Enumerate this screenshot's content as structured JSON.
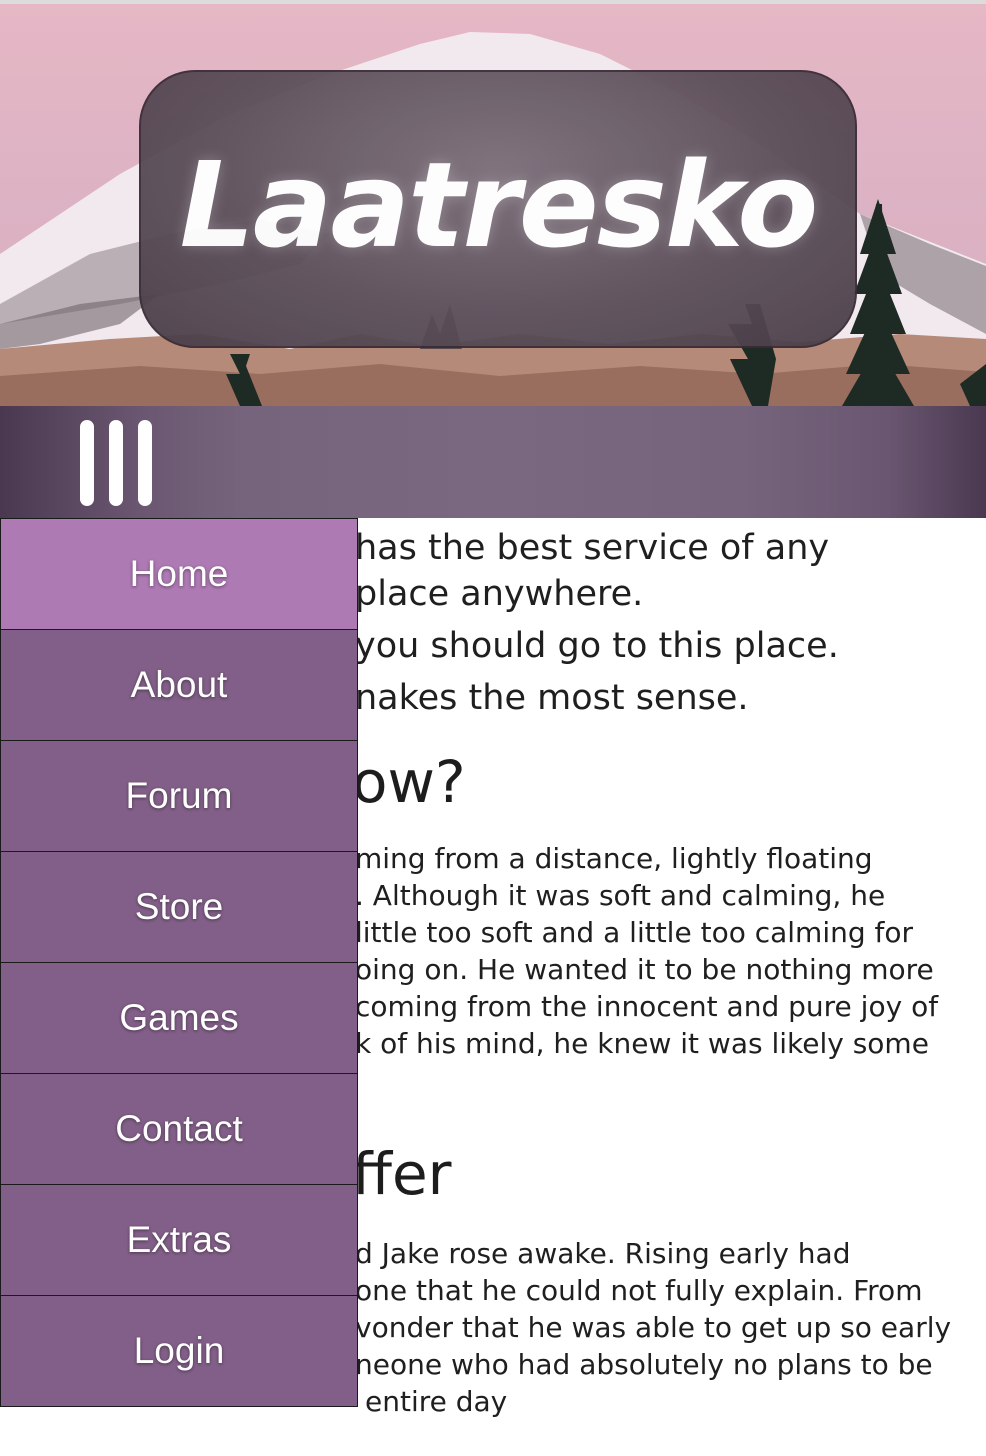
{
  "site": {
    "title": "Laatresko"
  },
  "nav": {
    "menu_icon": "hamburger-menu-icon",
    "items": [
      {
        "label": "Home",
        "active": true
      },
      {
        "label": "About",
        "active": false
      },
      {
        "label": "Forum",
        "active": false
      },
      {
        "label": "Store",
        "active": false
      },
      {
        "label": "Games",
        "active": false
      },
      {
        "label": "Contact",
        "active": false
      },
      {
        "label": "Extras",
        "active": false
      },
      {
        "label": "Login",
        "active": false
      }
    ]
  },
  "article": {
    "intro_lines": [
      "has the best service of any",
      "place anywhere.",
      "you should go to this place.",
      "nakes the most sense."
    ],
    "section1": {
      "heading": "ow?",
      "lines": [
        "ming from a distance, lightly floating",
        ". Although it was soft and calming, he",
        "little too soft and a little too calming for",
        "oing on. He wanted it to be nothing more",
        "coming from the innocent and pure joy of",
        "k of his mind, he knew it was likely some"
      ]
    },
    "section2": {
      "heading": "ffer",
      "lines": [
        "d Jake rose awake. Rising early had",
        "one that he could not fully explain. From",
        "vonder that he was able to get up so early",
        "neone who had absolutely no plans to be",
        "entire day"
      ]
    }
  },
  "colors": {
    "menu_item": "#825f88",
    "menu_item_active": "#ae7ab4",
    "navbar": "#7a6880",
    "title_card": "#5c4f5a"
  }
}
